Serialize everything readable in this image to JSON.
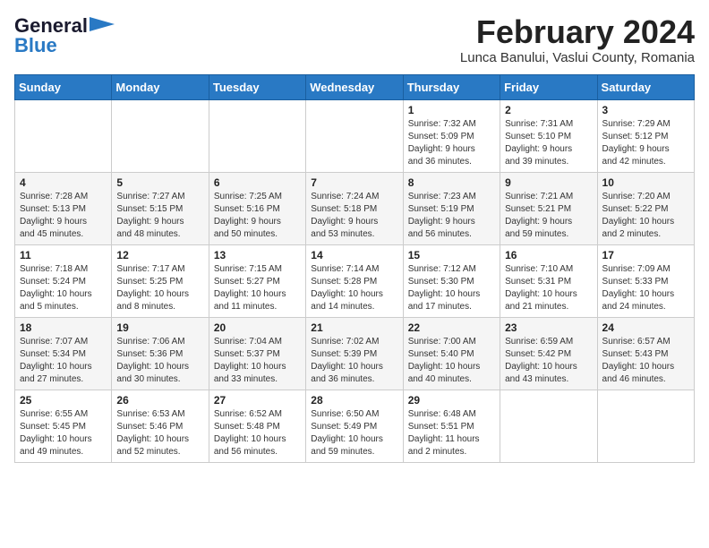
{
  "header": {
    "logo_general": "General",
    "logo_blue": "Blue",
    "month_year": "February 2024",
    "location": "Lunca Banului, Vaslui County, Romania"
  },
  "weekdays": [
    "Sunday",
    "Monday",
    "Tuesday",
    "Wednesday",
    "Thursday",
    "Friday",
    "Saturday"
  ],
  "weeks": [
    [
      {
        "day": "",
        "detail": ""
      },
      {
        "day": "",
        "detail": ""
      },
      {
        "day": "",
        "detail": ""
      },
      {
        "day": "",
        "detail": ""
      },
      {
        "day": "1",
        "detail": "Sunrise: 7:32 AM\nSunset: 5:09 PM\nDaylight: 9 hours\nand 36 minutes."
      },
      {
        "day": "2",
        "detail": "Sunrise: 7:31 AM\nSunset: 5:10 PM\nDaylight: 9 hours\nand 39 minutes."
      },
      {
        "day": "3",
        "detail": "Sunrise: 7:29 AM\nSunset: 5:12 PM\nDaylight: 9 hours\nand 42 minutes."
      }
    ],
    [
      {
        "day": "4",
        "detail": "Sunrise: 7:28 AM\nSunset: 5:13 PM\nDaylight: 9 hours\nand 45 minutes."
      },
      {
        "day": "5",
        "detail": "Sunrise: 7:27 AM\nSunset: 5:15 PM\nDaylight: 9 hours\nand 48 minutes."
      },
      {
        "day": "6",
        "detail": "Sunrise: 7:25 AM\nSunset: 5:16 PM\nDaylight: 9 hours\nand 50 minutes."
      },
      {
        "day": "7",
        "detail": "Sunrise: 7:24 AM\nSunset: 5:18 PM\nDaylight: 9 hours\nand 53 minutes."
      },
      {
        "day": "8",
        "detail": "Sunrise: 7:23 AM\nSunset: 5:19 PM\nDaylight: 9 hours\nand 56 minutes."
      },
      {
        "day": "9",
        "detail": "Sunrise: 7:21 AM\nSunset: 5:21 PM\nDaylight: 9 hours\nand 59 minutes."
      },
      {
        "day": "10",
        "detail": "Sunrise: 7:20 AM\nSunset: 5:22 PM\nDaylight: 10 hours\nand 2 minutes."
      }
    ],
    [
      {
        "day": "11",
        "detail": "Sunrise: 7:18 AM\nSunset: 5:24 PM\nDaylight: 10 hours\nand 5 minutes."
      },
      {
        "day": "12",
        "detail": "Sunrise: 7:17 AM\nSunset: 5:25 PM\nDaylight: 10 hours\nand 8 minutes."
      },
      {
        "day": "13",
        "detail": "Sunrise: 7:15 AM\nSunset: 5:27 PM\nDaylight: 10 hours\nand 11 minutes."
      },
      {
        "day": "14",
        "detail": "Sunrise: 7:14 AM\nSunset: 5:28 PM\nDaylight: 10 hours\nand 14 minutes."
      },
      {
        "day": "15",
        "detail": "Sunrise: 7:12 AM\nSunset: 5:30 PM\nDaylight: 10 hours\nand 17 minutes."
      },
      {
        "day": "16",
        "detail": "Sunrise: 7:10 AM\nSunset: 5:31 PM\nDaylight: 10 hours\nand 21 minutes."
      },
      {
        "day": "17",
        "detail": "Sunrise: 7:09 AM\nSunset: 5:33 PM\nDaylight: 10 hours\nand 24 minutes."
      }
    ],
    [
      {
        "day": "18",
        "detail": "Sunrise: 7:07 AM\nSunset: 5:34 PM\nDaylight: 10 hours\nand 27 minutes."
      },
      {
        "day": "19",
        "detail": "Sunrise: 7:06 AM\nSunset: 5:36 PM\nDaylight: 10 hours\nand 30 minutes."
      },
      {
        "day": "20",
        "detail": "Sunrise: 7:04 AM\nSunset: 5:37 PM\nDaylight: 10 hours\nand 33 minutes."
      },
      {
        "day": "21",
        "detail": "Sunrise: 7:02 AM\nSunset: 5:39 PM\nDaylight: 10 hours\nand 36 minutes."
      },
      {
        "day": "22",
        "detail": "Sunrise: 7:00 AM\nSunset: 5:40 PM\nDaylight: 10 hours\nand 40 minutes."
      },
      {
        "day": "23",
        "detail": "Sunrise: 6:59 AM\nSunset: 5:42 PM\nDaylight: 10 hours\nand 43 minutes."
      },
      {
        "day": "24",
        "detail": "Sunrise: 6:57 AM\nSunset: 5:43 PM\nDaylight: 10 hours\nand 46 minutes."
      }
    ],
    [
      {
        "day": "25",
        "detail": "Sunrise: 6:55 AM\nSunset: 5:45 PM\nDaylight: 10 hours\nand 49 minutes."
      },
      {
        "day": "26",
        "detail": "Sunrise: 6:53 AM\nSunset: 5:46 PM\nDaylight: 10 hours\nand 52 minutes."
      },
      {
        "day": "27",
        "detail": "Sunrise: 6:52 AM\nSunset: 5:48 PM\nDaylight: 10 hours\nand 56 minutes."
      },
      {
        "day": "28",
        "detail": "Sunrise: 6:50 AM\nSunset: 5:49 PM\nDaylight: 10 hours\nand 59 minutes."
      },
      {
        "day": "29",
        "detail": "Sunrise: 6:48 AM\nSunset: 5:51 PM\nDaylight: 11 hours\nand 2 minutes."
      },
      {
        "day": "",
        "detail": ""
      },
      {
        "day": "",
        "detail": ""
      }
    ]
  ]
}
